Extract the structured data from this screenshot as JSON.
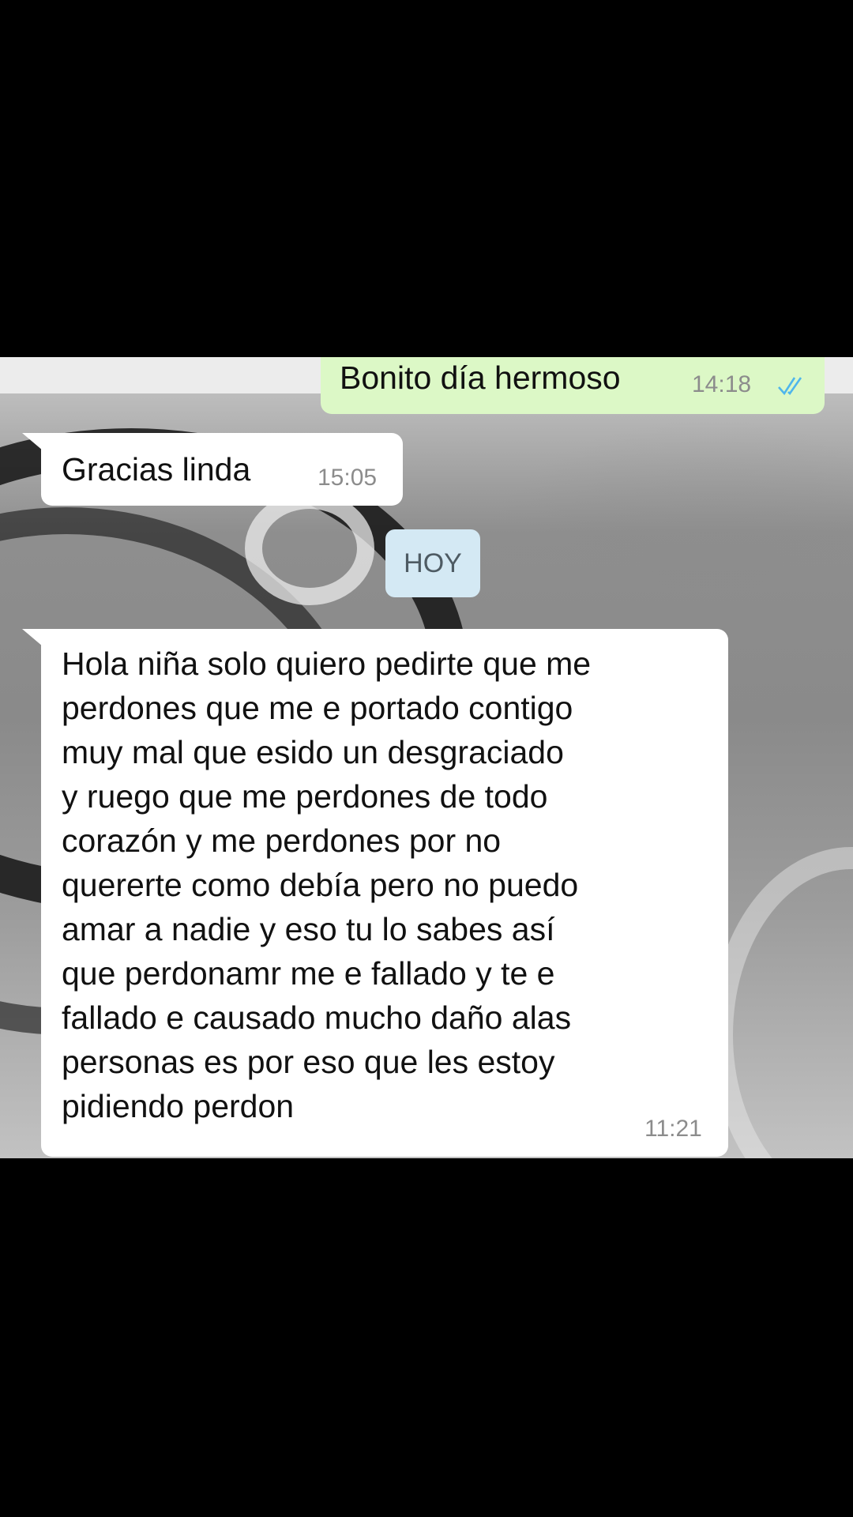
{
  "chat": {
    "messages": [
      {
        "direction": "outgoing",
        "text": "Bonito día hermoso",
        "time": "14:18",
        "status_icon": "double-check-read-icon"
      },
      {
        "direction": "incoming",
        "text": "Gracias linda",
        "time": "15:05"
      },
      {
        "direction": "incoming",
        "text": "Hola niña solo quiero pedirte que me\nperdones que me e portado contigo\nmuy mal que esido un desgraciado\ny ruego que me perdones de todo\ncorazón y me perdones por no\nquererte como debía pero no puedo\namar a nadie y eso tu lo sabes así\nque perdonamr me e fallado y te e\nfallado e causado mucho daño alas\npersonas es por eso que les estoy\npidiendo perdon",
        "time": "11:21"
      }
    ],
    "date_separator": "HOY"
  },
  "colors": {
    "outgoing_bubble": "#dcf8c6",
    "incoming_bubble": "#ffffff",
    "date_pill": "#d4e9f4",
    "read_ticks": "#4fb6ec",
    "letterbox": "#000000"
  }
}
